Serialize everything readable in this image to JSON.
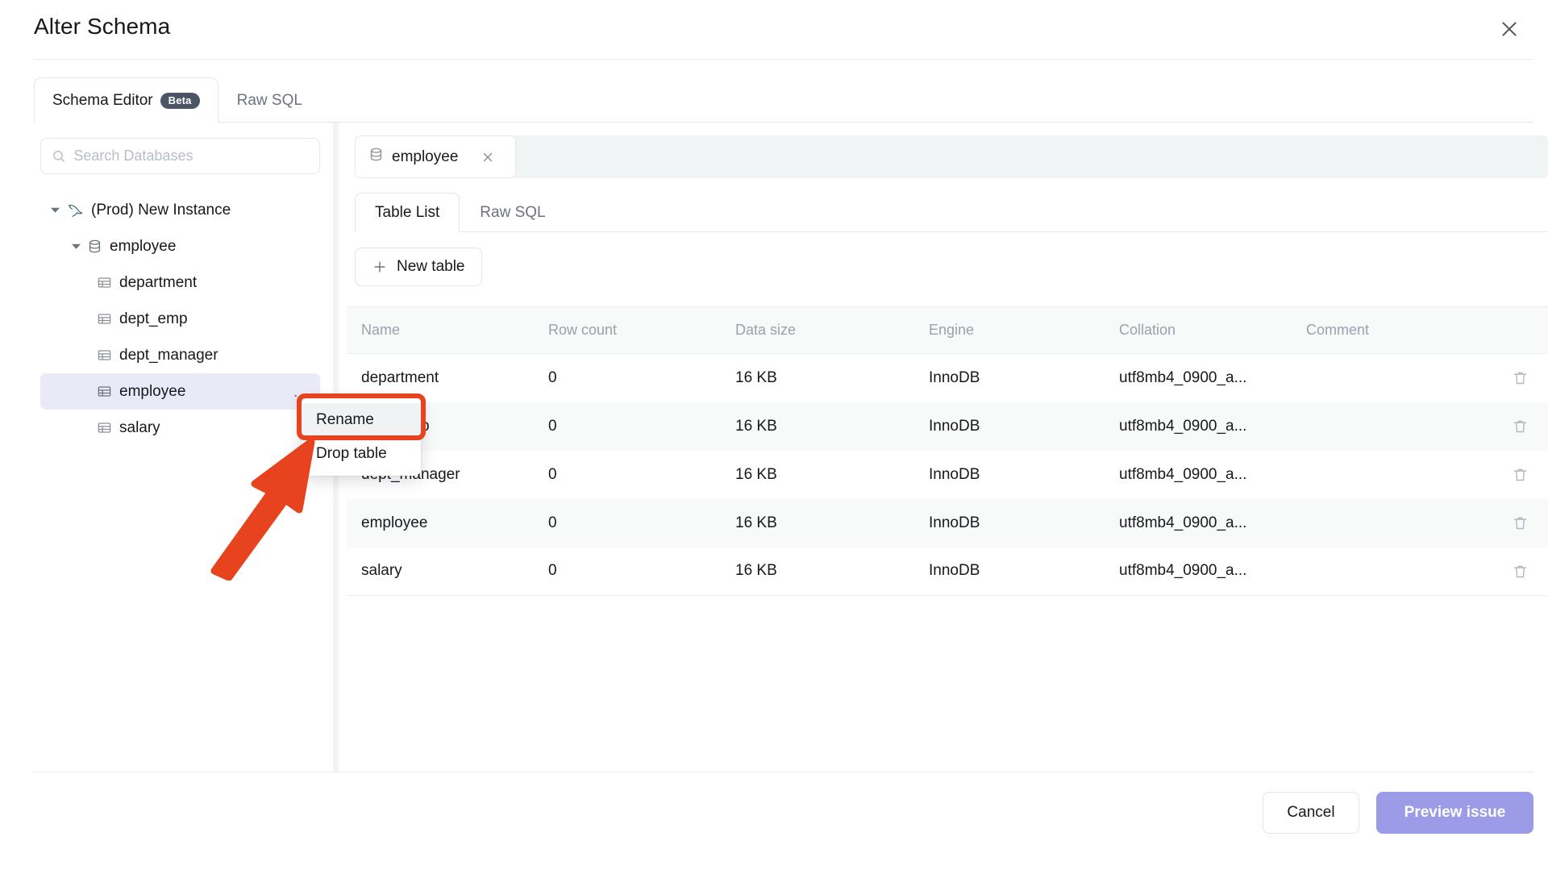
{
  "dialog": {
    "title": "Alter Schema",
    "close_icon": "close-icon"
  },
  "top_tabs": [
    {
      "label": "Schema Editor",
      "badge": "Beta",
      "active": true
    },
    {
      "label": "Raw SQL",
      "badge": "",
      "active": false
    }
  ],
  "sidebar": {
    "search": {
      "placeholder": "Search Databases",
      "value": "",
      "icon": "search-icon"
    },
    "tree": [
      {
        "label": "(Prod) New Instance",
        "level": 0,
        "icon": "mysql-dolphin-icon",
        "expanded": true,
        "selected": false,
        "more": ""
      },
      {
        "label": "employee",
        "level": 1,
        "icon": "database-icon",
        "expanded": true,
        "selected": false,
        "more": ""
      },
      {
        "label": "department",
        "level": 2,
        "icon": "table-icon",
        "expanded": null,
        "selected": false,
        "more": ""
      },
      {
        "label": "dept_emp",
        "level": 2,
        "icon": "table-icon",
        "expanded": null,
        "selected": false,
        "more": ""
      },
      {
        "label": "dept_manager",
        "level": 2,
        "icon": "table-icon",
        "expanded": null,
        "selected": false,
        "more": ""
      },
      {
        "label": "employee",
        "level": 2,
        "icon": "table-icon",
        "expanded": null,
        "selected": true,
        "more": "…"
      },
      {
        "label": "salary",
        "level": 2,
        "icon": "table-icon",
        "expanded": null,
        "selected": false,
        "more": ""
      }
    ]
  },
  "right_pane": {
    "chip": {
      "label": "employee",
      "icon": "database-icon",
      "close_icon": "close-icon"
    },
    "subtabs": [
      {
        "label": "Table List",
        "active": true
      },
      {
        "label": "Raw SQL",
        "active": false
      }
    ],
    "new_table_button": {
      "label": "New table",
      "icon": "plus-icon"
    },
    "table": {
      "columns": [
        "Name",
        "Row count",
        "Data size",
        "Engine",
        "Collation",
        "Comment",
        ""
      ],
      "rows": [
        {
          "name": "department",
          "row_count": "0",
          "data_size": "16 KB",
          "engine": "InnoDB",
          "collation": "utf8mb4_0900_a...",
          "comment": ""
        },
        {
          "name": "dept_emp",
          "row_count": "0",
          "data_size": "16 KB",
          "engine": "InnoDB",
          "collation": "utf8mb4_0900_a...",
          "comment": ""
        },
        {
          "name": "dept_manager",
          "row_count": "0",
          "data_size": "16 KB",
          "engine": "InnoDB",
          "collation": "utf8mb4_0900_a...",
          "comment": ""
        },
        {
          "name": "employee",
          "row_count": "0",
          "data_size": "16 KB",
          "engine": "InnoDB",
          "collation": "utf8mb4_0900_a...",
          "comment": ""
        },
        {
          "name": "salary",
          "row_count": "0",
          "data_size": "16 KB",
          "engine": "InnoDB",
          "collation": "utf8mb4_0900_a...",
          "comment": ""
        }
      ],
      "row_action_icon": "trash-icon"
    }
  },
  "context_menu": {
    "items": [
      {
        "label": "Rename",
        "hovered": true
      },
      {
        "label": "Drop table",
        "hovered": false
      }
    ]
  },
  "annotation": {
    "color": "#e8431f",
    "arrow_icon": "arrow-pointer-icon",
    "highlight_target": "Rename"
  },
  "footer": {
    "cancel_label": "Cancel",
    "primary_label": "Preview issue",
    "primary_color": "#9b9be8"
  }
}
